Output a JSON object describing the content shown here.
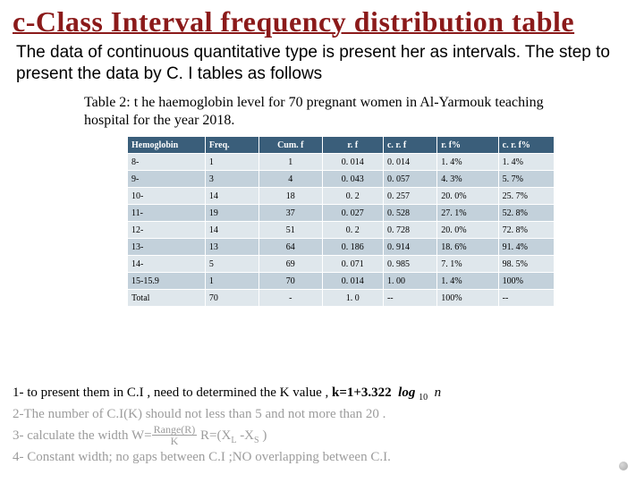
{
  "title": "c-Class Interval frequency distribution table",
  "intro": "The data of continuous quantitative  type is present her as intervals. The step to present the data by C. I tables as follows",
  "caption": "Table  2: t he haemoglobin  level for 70 pregnant women in Al-Yarmouk teaching hospital for the year 2018.",
  "table": {
    "headers": [
      "Hemoglobin",
      "Freq.",
      "Cum. f",
      "r. f",
      "c. r. f",
      "r. f%",
      "c. r. f%"
    ],
    "rows": [
      [
        "8-",
        "1",
        "1",
        "0. 014",
        "0. 014",
        "1. 4%",
        "1. 4%"
      ],
      [
        "9-",
        "3",
        "4",
        "0. 043",
        "0. 057",
        "4. 3%",
        "5. 7%"
      ],
      [
        "10-",
        "14",
        "18",
        "0. 2",
        "0. 257",
        "20. 0%",
        "25. 7%"
      ],
      [
        "11-",
        "19",
        "37",
        "0. 027",
        "0. 528",
        "27. 1%",
        "52. 8%"
      ],
      [
        "12-",
        "14",
        "51",
        "0. 2",
        "0. 728",
        "20. 0%",
        "72. 8%"
      ],
      [
        "13-",
        "13",
        "64",
        "0. 186",
        "0. 914",
        "18. 6%",
        "91. 4%"
      ],
      [
        "14-",
        "5",
        "69",
        "0. 071",
        "0. 985",
        "7. 1%",
        "98. 5%"
      ],
      [
        "15-15.9",
        "1",
        "70",
        "0. 014",
        "1. 00",
        "1. 4%",
        "100%"
      ],
      [
        "Total",
        "70",
        "-",
        "1. 0",
        "--",
        "100%",
        "--"
      ]
    ]
  },
  "steps": {
    "s1_pre": "1- to present them in C.I , need to determined the K value , ",
    "s1_bold": "k=1+3.322",
    "s1_log": "log",
    "s1_sub": "10",
    "s1_n": "n",
    "s2": "2-The number of C.I(K) should not less than 5 and not more than 20 .",
    "s3_pre": "3- calculate the width W=",
    "s3_num": "Range(R)",
    "s3_den": "K",
    "s3_post": "   R=(X",
    "s3_L": "L",
    "s3_mid": " -X",
    "s3_S": "S",
    "s3_end": " )",
    "s4": "4- Constant width; no gaps between C.I ;NO overlapping between C.I."
  },
  "chart_data": {
    "type": "table",
    "title": "haemoglobin level for 70 pregnant women in Al-Yarmouk teaching hospital 2018",
    "columns": [
      "Hemoglobin",
      "Freq.",
      "Cum. f",
      "r.f",
      "c.r.f",
      "r.f%",
      "c.r.f%"
    ],
    "rows": [
      {
        "Hemoglobin": "8-",
        "Freq": 1,
        "Cumf": 1,
        "rf": 0.014,
        "crf": 0.014,
        "rf_pct": 1.4,
        "crf_pct": 1.4
      },
      {
        "Hemoglobin": "9-",
        "Freq": 3,
        "Cumf": 4,
        "rf": 0.043,
        "crf": 0.057,
        "rf_pct": 4.3,
        "crf_pct": 5.7
      },
      {
        "Hemoglobin": "10-",
        "Freq": 14,
        "Cumf": 18,
        "rf": 0.2,
        "crf": 0.257,
        "rf_pct": 20.0,
        "crf_pct": 25.7
      },
      {
        "Hemoglobin": "11-",
        "Freq": 19,
        "Cumf": 37,
        "rf": 0.027,
        "crf": 0.528,
        "rf_pct": 27.1,
        "crf_pct": 52.8
      },
      {
        "Hemoglobin": "12-",
        "Freq": 14,
        "Cumf": 51,
        "rf": 0.2,
        "crf": 0.728,
        "rf_pct": 20.0,
        "crf_pct": 72.8
      },
      {
        "Hemoglobin": "13-",
        "Freq": 13,
        "Cumf": 64,
        "rf": 0.186,
        "crf": 0.914,
        "rf_pct": 18.6,
        "crf_pct": 91.4
      },
      {
        "Hemoglobin": "14-",
        "Freq": 5,
        "Cumf": 69,
        "rf": 0.071,
        "crf": 0.985,
        "rf_pct": 7.1,
        "crf_pct": 98.5
      },
      {
        "Hemoglobin": "15-15.9",
        "Freq": 1,
        "Cumf": 70,
        "rf": 0.014,
        "crf": 1.0,
        "rf_pct": 1.4,
        "crf_pct": 100
      },
      {
        "Hemoglobin": "Total",
        "Freq": 70,
        "Cumf": null,
        "rf": 1.0,
        "crf": null,
        "rf_pct": 100,
        "crf_pct": null
      }
    ]
  }
}
